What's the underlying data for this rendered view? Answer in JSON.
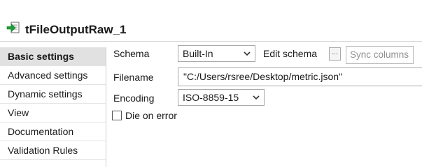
{
  "component": {
    "title": "tFileOutputRaw_1",
    "icon": "file-output-icon"
  },
  "sidebar": {
    "items": [
      {
        "label": "Basic settings",
        "active": true
      },
      {
        "label": "Advanced settings",
        "active": false
      },
      {
        "label": "Dynamic settings",
        "active": false
      },
      {
        "label": "View",
        "active": false
      },
      {
        "label": "Documentation",
        "active": false
      },
      {
        "label": "Validation Rules",
        "active": false
      }
    ]
  },
  "settings": {
    "schema_label": "Schema",
    "schema_value": "Built-In",
    "edit_schema_label": "Edit schema",
    "edit_schema_button": "...",
    "sync_columns_label": "Sync columns",
    "filename_label": "Filename",
    "filename_value": "\"C:/Users/rsree/Desktop/metric.json\"",
    "encoding_label": "Encoding",
    "encoding_value": "ISO-8859-15",
    "die_on_error_label": "Die on error",
    "die_on_error_checked": false
  },
  "colors": {
    "active_tab_bg": "#e1e1e1",
    "icon_green": "#1e9e3a",
    "disabled_text": "#8f8f8f"
  }
}
